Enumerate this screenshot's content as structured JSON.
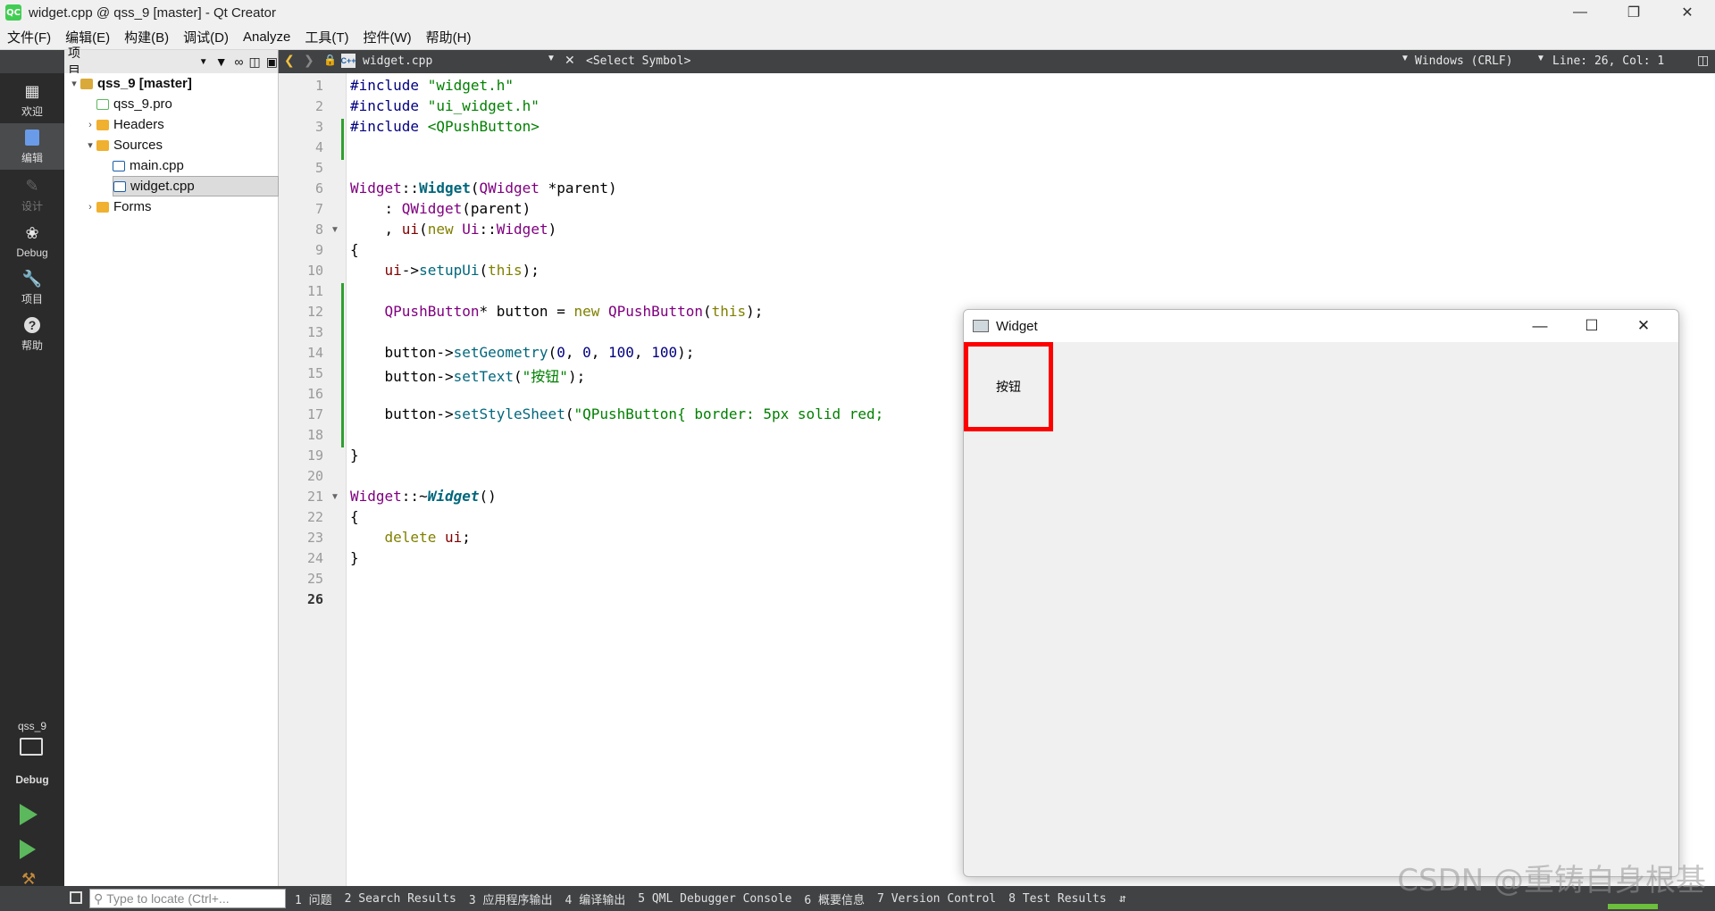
{
  "window": {
    "title": "widget.cpp @ qss_9 [master] - Qt Creator",
    "app_icon": "QC"
  },
  "menu": [
    "文件(F)",
    "编辑(E)",
    "构建(B)",
    "调试(D)",
    "Analyze",
    "工具(T)",
    "控件(W)",
    "帮助(H)"
  ],
  "toolbar": {
    "project_label": "项目",
    "file_name": "widget.cpp",
    "symbol": "<Select Symbol>",
    "line_ending": "Windows (CRLF)",
    "position": "Line: 26, Col: 1"
  },
  "modes": [
    {
      "label": "欢迎",
      "icon": "grid-icon"
    },
    {
      "label": "编辑",
      "icon": "edit-doc-icon"
    },
    {
      "label": "设计",
      "icon": "pencil-icon"
    },
    {
      "label": "Debug",
      "icon": "bug-icon"
    },
    {
      "label": "项目",
      "icon": "wrench-icon"
    },
    {
      "label": "帮助",
      "icon": "help-icon"
    }
  ],
  "kit": {
    "project": "qss_9",
    "config": "Debug"
  },
  "tree": [
    {
      "label": "qss_9 [master]",
      "indent": 0,
      "arrow": "▾"
    },
    {
      "label": "qss_9.pro",
      "indent": 1,
      "arrow": ""
    },
    {
      "label": "Headers",
      "indent": 1,
      "arrow": "›"
    },
    {
      "label": "Sources",
      "indent": 1,
      "arrow": "▾"
    },
    {
      "label": "main.cpp",
      "indent": 2,
      "arrow": ""
    },
    {
      "label": "widget.cpp",
      "indent": 2,
      "arrow": ""
    },
    {
      "label": "Forms",
      "indent": 1,
      "arrow": "›"
    }
  ],
  "line_numbers": [
    "1",
    "2",
    "3",
    "4",
    "5",
    "6",
    "7",
    "8",
    "9",
    "10",
    "11",
    "12",
    "13",
    "14",
    "15",
    "16",
    "17",
    "18",
    "19",
    "20",
    "21",
    "22",
    "23",
    "24",
    "25",
    "26"
  ],
  "code": {
    "l1a": "#include ",
    "l1b": "\"widget.h\"",
    "l2a": "#include ",
    "l2b": "\"ui_widget.h\"",
    "l3a": "#include ",
    "l3b": "<QPushButton>",
    "l6a": "Widget",
    "l6b": "::",
    "l6c": "Widget",
    "l6d": "(",
    "l6e": "QWidget",
    "l6f": " *",
    "l6g": "parent",
    "l6h": ")",
    "l7a": "    : ",
    "l7b": "QWidget",
    "l7c": "(parent)",
    "l8a": "    , ",
    "l8b": "ui",
    "l8c": "(",
    "l8d": "new",
    "l8e": " ",
    "l8f": "Ui",
    "l8g": "::",
    "l8h": "Widget",
    "l8i": ")",
    "l9": "{",
    "l10a": "    ",
    "l10b": "ui",
    "l10c": "->",
    "l10d": "setupUi",
    "l10e": "(",
    "l10f": "this",
    "l10g": ");",
    "l12a": "    ",
    "l12b": "QPushButton",
    "l12c": "* button = ",
    "l12d": "new",
    "l12e": " ",
    "l12f": "QPushButton",
    "l12g": "(",
    "l12h": "this",
    "l12i": ");",
    "l14a": "    button->",
    "l14b": "setGeometry",
    "l14c": "(",
    "l14d": "0",
    "l14e": ", ",
    "l14f": "0",
    "l14g": ", ",
    "l14h": "100",
    "l14i": ", ",
    "l14j": "100",
    "l14k": ");",
    "l15a": "    button->",
    "l15b": "setText",
    "l15c": "(",
    "l15d": "\"按钮\"",
    "l15e": ");",
    "l17a": "    button->",
    "l17b": "setStyleSheet",
    "l17c": "(",
    "l17d": "\"QPushButton{ border: 5px solid red;",
    "l19": "}",
    "l21a": "Widget",
    "l21b": "::~",
    "l21c": "Widget",
    "l21d": "()",
    "l22": "{",
    "l23a": "    ",
    "l23b": "delete",
    "l23c": " ",
    "l23d": "ui",
    "l23e": ";",
    "l24": "}"
  },
  "widget_window": {
    "title": "Widget",
    "button_text": "按钮",
    "button_border_color": "#ff0000"
  },
  "statusbar": {
    "locate_placeholder": "Type to locate (Ctrl+...",
    "panes": [
      "1 问题",
      "2 Search Results",
      "3 应用程序输出",
      "4 编译输出",
      "5 QML Debugger Console",
      "6 概要信息",
      "7 Version Control",
      "8 Test Results"
    ]
  },
  "watermark": "CSDN @重铸自身根基"
}
